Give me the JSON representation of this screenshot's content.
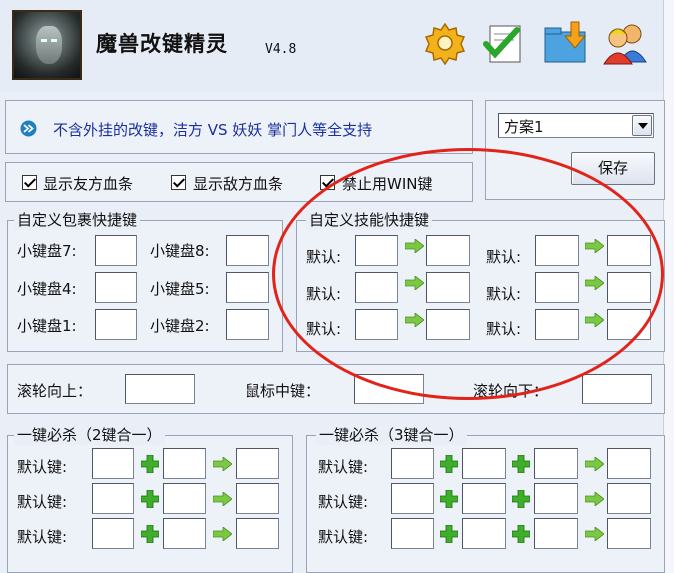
{
  "app": {
    "title": "魔兽改键精灵",
    "version": "V4.8"
  },
  "toolbar": {
    "icons": [
      "gear-icon",
      "checklist-icon",
      "download-folder-icon",
      "users-icon"
    ]
  },
  "notice": {
    "text": "不含外挂的改键，洁方 VS 妖妖 掌门人等全支持"
  },
  "scheme": {
    "selected": "方案1",
    "save_label": "保存"
  },
  "options": [
    {
      "label": "显示友方血条",
      "checked": true
    },
    {
      "label": "显示敌方血条",
      "checked": true
    },
    {
      "label": "禁止用WIN键",
      "checked": true
    }
  ],
  "inventory": {
    "legend": "自定义包裹快捷键",
    "rows": [
      [
        "小键盘7:",
        "小键盘8:"
      ],
      [
        "小键盘4:",
        "小键盘5:"
      ],
      [
        "小键盘1:",
        "小键盘2:"
      ]
    ]
  },
  "skills": {
    "legend": "自定义技能快捷键",
    "label": "默认:"
  },
  "mouse": {
    "wheel_up": "滚轮向上：",
    "middle": "鼠标中键：",
    "wheel_down": "滚轮向下："
  },
  "combo2": {
    "legend": "一键必杀（2键合一）",
    "label": "默认键:"
  },
  "combo3": {
    "legend": "一键必杀（3键合一）",
    "label": "默认键:"
  },
  "colors": {
    "accent_red": "#e2231a",
    "arrow_green": "#7ac943",
    "plus_green": "#3fae2a",
    "notice_blue": "#1c2fa0"
  }
}
